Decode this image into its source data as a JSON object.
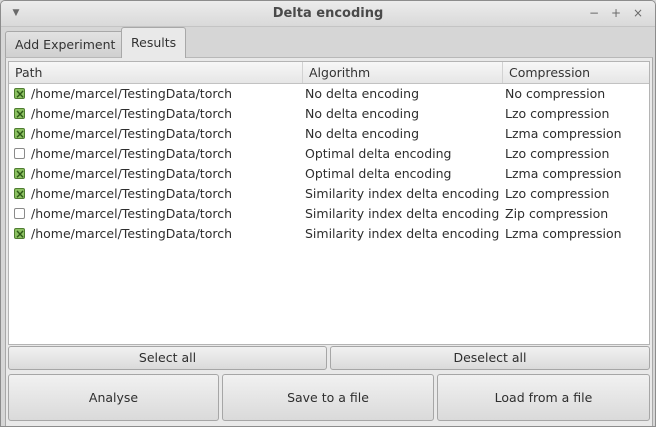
{
  "window": {
    "title": "Delta encoding"
  },
  "tabs": [
    {
      "label": "Add Experiment",
      "active": false
    },
    {
      "label": "Results",
      "active": true
    }
  ],
  "table": {
    "columns": [
      "Path",
      "Algorithm",
      "Compression"
    ],
    "rows": [
      {
        "checked": true,
        "path": "/home/marcel/TestingData/torch",
        "algorithm": "No delta encoding",
        "compression": "No compression"
      },
      {
        "checked": true,
        "path": "/home/marcel/TestingData/torch",
        "algorithm": "No delta encoding",
        "compression": "Lzo compression"
      },
      {
        "checked": true,
        "path": "/home/marcel/TestingData/torch",
        "algorithm": "No delta encoding",
        "compression": "Lzma compression"
      },
      {
        "checked": false,
        "path": "/home/marcel/TestingData/torch",
        "algorithm": "Optimal delta encoding",
        "compression": "Lzo compression"
      },
      {
        "checked": true,
        "path": "/home/marcel/TestingData/torch",
        "algorithm": "Optimal delta encoding",
        "compression": "Lzma compression"
      },
      {
        "checked": true,
        "path": "/home/marcel/TestingData/torch",
        "algorithm": "Similarity index delta encoding",
        "compression": "Lzo compression"
      },
      {
        "checked": false,
        "path": "/home/marcel/TestingData/torch",
        "algorithm": "Similarity index delta encoding",
        "compression": "Zip compression"
      },
      {
        "checked": true,
        "path": "/home/marcel/TestingData/torch",
        "algorithm": "Similarity index delta encoding",
        "compression": "Lzma compression"
      }
    ]
  },
  "buttons": {
    "select_all": "Select all",
    "deselect_all": "Deselect all",
    "analyse": "Analyse",
    "save": "Save to a file",
    "load": "Load from a file"
  },
  "icons": {
    "window_menu": "chevron-down-icon",
    "minimize": "minimize-icon",
    "maximize": "maximize-icon",
    "close": "close-icon"
  },
  "colors": {
    "check_fill": "#8dc263",
    "check_border": "#4f7d31"
  }
}
